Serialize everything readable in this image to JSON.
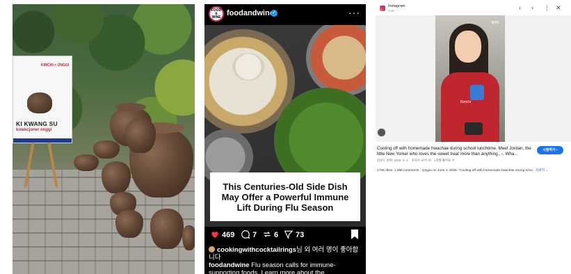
{
  "panel_photo": {
    "poster": {
      "tagline": "KIMCHI × ONGGI",
      "artist_name": "KI KWANG SU",
      "artist_subtitle": "kolekcjoner onggi"
    }
  },
  "post": {
    "username": "foodandwine",
    "avatar_text": "FOOD & WINE",
    "more_icon": "more-horizontal-icon",
    "image_caption": "This Centuries-Old Side Dish May Offer a Powerful Immune Lift During Flu Season",
    "actions": {
      "likes": "469",
      "comments": "7",
      "reposts": "6",
      "shares": "73"
    },
    "liked_by_user": "cookingwithcocktailrings",
    "liked_by_text": "님 외 여러 명이 좋아합니다",
    "caption_user": "foodandwine",
    "caption_text": "Flu season calls for immune-supporting foods. Learn more about the"
  },
  "viewer": {
    "app_name": "Instagram",
    "app_sub": "3:46",
    "nav": {
      "back": "‹",
      "forward": "›",
      "menu": "⋮",
      "close": "✕"
    },
    "image_tag": "NYC",
    "cup_label": "Kimchi",
    "description": "Cooling off with homemade hwachae during school lunchtime. Meet Jordan, the little New Yorker who loves the sweet treat more than anything., -, Wha...",
    "meta": "업로드 날짜: 2026. 6. 4. · 조회수 37억 회 · 1개월 좋아요 수",
    "button_label": "시청하기 ›",
    "stats": "176K likes, 1,388 comments - ryogav on June 4, 2026: \"Cooling off with homemade hwachae during scho",
    "more_link": "자세히 ⌄"
  }
}
